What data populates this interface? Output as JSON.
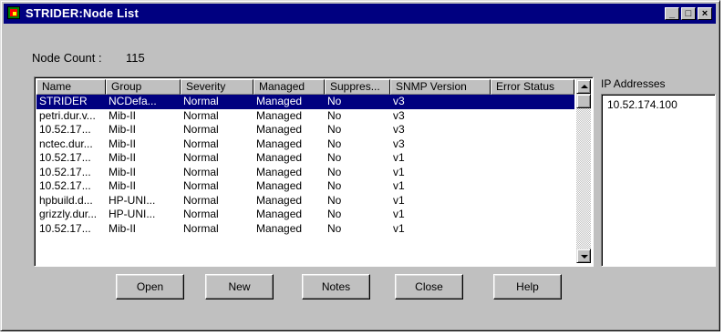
{
  "window": {
    "title": "STRIDER:Node List",
    "minimize_label": "_",
    "maximize_label": "□",
    "close_label": "×"
  },
  "node_count": {
    "label": "Node Count :",
    "value": "115"
  },
  "table": {
    "columns": [
      "Name",
      "Group",
      "Severity",
      "Managed",
      "Suppres...",
      "SNMP Version",
      "Error Status"
    ],
    "selected_row": 0,
    "rows": [
      [
        "STRIDER",
        "NCDefa...",
        "Normal",
        "Managed",
        "No",
        "v3",
        ""
      ],
      [
        "petri.dur.v...",
        "Mib-II",
        "Normal",
        "Managed",
        "No",
        "v3",
        ""
      ],
      [
        "10.52.17...",
        "Mib-II",
        "Normal",
        "Managed",
        "No",
        "v3",
        ""
      ],
      [
        "nctec.dur...",
        "Mib-II",
        "Normal",
        "Managed",
        "No",
        "v3",
        ""
      ],
      [
        "10.52.17...",
        "Mib-II",
        "Normal",
        "Managed",
        "No",
        "v1",
        ""
      ],
      [
        "10.52.17...",
        "Mib-II",
        "Normal",
        "Managed",
        "No",
        "v1",
        ""
      ],
      [
        "10.52.17...",
        "Mib-II",
        "Normal",
        "Managed",
        "No",
        "v1",
        ""
      ],
      [
        "hpbuild.d...",
        "HP-UNI...",
        "Normal",
        "Managed",
        "No",
        "v1",
        ""
      ],
      [
        "grizzly.dur...",
        "HP-UNI...",
        "Normal",
        "Managed",
        "No",
        "v1",
        ""
      ],
      [
        "10.52.17...",
        "Mib-II",
        "Normal",
        "Managed",
        "No",
        "v1",
        ""
      ]
    ]
  },
  "ip_addresses": {
    "label": "IP Addresses",
    "items": [
      "10.52.174.100"
    ]
  },
  "buttons": {
    "open": "Open",
    "new": "New",
    "notes": "Notes",
    "close": "Close",
    "help": "Help"
  },
  "colors": {
    "title_bar": "#000080",
    "face": "#c0c0c0",
    "selection": "#000080"
  }
}
